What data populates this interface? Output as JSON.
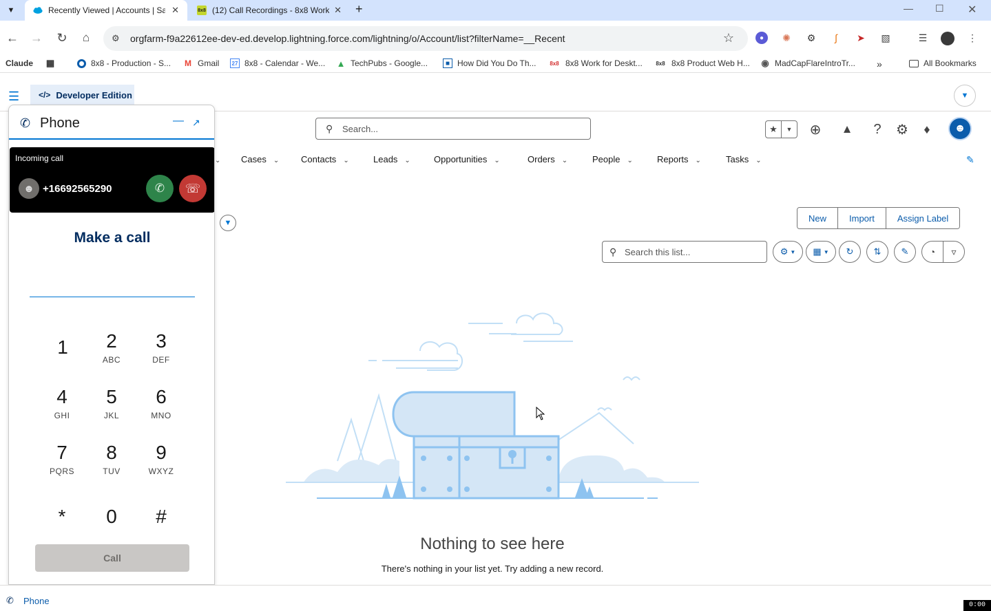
{
  "browser": {
    "tabs": [
      {
        "title": "Recently Viewed | Accounts | Sa",
        "active": true
      },
      {
        "title": "(12) Call Recordings - 8x8 Work",
        "active": false
      }
    ],
    "url": "orgfarm-f9a22612ee-dev-ed.develop.lightning.force.com/lightning/o/Account/list?filterName=__Recent",
    "bookmarks": [
      {
        "label": "Claude",
        "icon": "claude-icon"
      },
      {
        "label": "8x8 - Production - S...",
        "icon": "circle-icon"
      },
      {
        "label": "Gmail",
        "icon": "gmail-icon"
      },
      {
        "label": "8x8 - Calendar - We...",
        "icon": "calendar-icon"
      },
      {
        "label": "TechPubs - Google...",
        "icon": "drive-icon"
      },
      {
        "label": "How Did You Do Th...",
        "icon": "doc-icon"
      },
      {
        "label": "8x8 Work for Deskt...",
        "icon": "8x8-icon"
      },
      {
        "label": "8x8 Product Web H...",
        "icon": "8x8-icon"
      },
      {
        "label": "MadCapFlareIntroTr...",
        "icon": "globe-icon"
      }
    ],
    "all_bookmarks": "All Bookmarks",
    "overflow": "»"
  },
  "sf": {
    "app_label": "Developer Edition",
    "search_placeholder": "Search...",
    "nav": [
      {
        "label": "Cases"
      },
      {
        "label": "Contacts"
      },
      {
        "label": "Leads"
      },
      {
        "label": "Opportunities"
      },
      {
        "label": "Orders"
      },
      {
        "label": "People"
      },
      {
        "label": "Reports"
      },
      {
        "label": "Tasks"
      }
    ],
    "actions": {
      "new": "New",
      "import": "Import",
      "assign_label": "Assign Label"
    },
    "list_search_placeholder": "Search this list...",
    "empty_title": "Nothing to see here",
    "empty_subtitle": "There's nothing in your list yet. Try adding a new record.",
    "accent": "#0176d3"
  },
  "phone": {
    "title": "Phone",
    "incoming_label": "Incoming call",
    "caller_number": "+16692565290",
    "make_call": "Make a call",
    "keys": [
      {
        "digit": "1",
        "letters": ""
      },
      {
        "digit": "2",
        "letters": "ABC"
      },
      {
        "digit": "3",
        "letters": "DEF"
      },
      {
        "digit": "4",
        "letters": "GHI"
      },
      {
        "digit": "5",
        "letters": "JKL"
      },
      {
        "digit": "6",
        "letters": "MNO"
      },
      {
        "digit": "7",
        "letters": "PQRS"
      },
      {
        "digit": "8",
        "letters": "TUV"
      },
      {
        "digit": "9",
        "letters": "WXYZ"
      },
      {
        "digit": "*",
        "letters": ""
      },
      {
        "digit": "0",
        "letters": ""
      },
      {
        "digit": "#",
        "letters": ""
      }
    ],
    "call_button": "Call",
    "accept_color": "#2e844a",
    "decline_color": "#c23934"
  },
  "utility": {
    "label": "Phone"
  },
  "timer": "0:00"
}
